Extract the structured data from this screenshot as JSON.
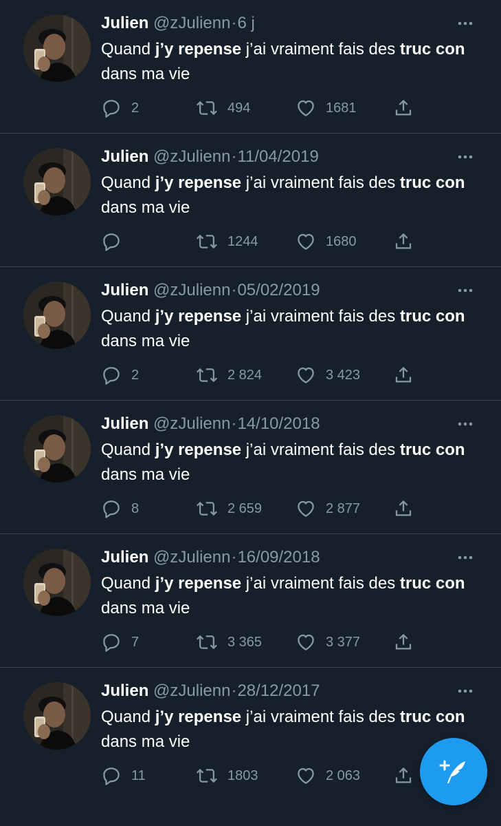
{
  "colors": {
    "background": "#15202b",
    "divider": "#38444d",
    "secondary_text": "#8899a6",
    "accent": "#1d9bf0"
  },
  "tweets": [
    {
      "name": "Julien",
      "handle": "@zJulienn",
      "separator": "·",
      "time": "6 j",
      "text": {
        "p1": "Quand ",
        "b1": "j’y repense",
        "p2": " j’ai vraiment fais des ",
        "b2": "truc con",
        "p3": " dans ma vie"
      },
      "replies": "2",
      "retweets": "494",
      "likes": "1681"
    },
    {
      "name": "Julien",
      "handle": "@zJulienn",
      "separator": "·",
      "time": "11/04/2019",
      "text": {
        "p1": "Quand ",
        "b1": "j’y repense",
        "p2": " j’ai vraiment fais des ",
        "b2": "truc con",
        "p3": " dans ma vie"
      },
      "replies": "",
      "retweets": "1244",
      "likes": "1680"
    },
    {
      "name": "Julien",
      "handle": "@zJulienn",
      "separator": "·",
      "time": "05/02/2019",
      "text": {
        "p1": "Quand ",
        "b1": "j’y repense",
        "p2": " j’ai vraiment fais des ",
        "b2": "truc con",
        "p3": " dans ma vie"
      },
      "replies": "2",
      "retweets": "2 824",
      "likes": "3 423"
    },
    {
      "name": "Julien",
      "handle": "@zJulienn",
      "separator": "·",
      "time": "14/10/2018",
      "text": {
        "p1": "Quand ",
        "b1": "j’y repense",
        "p2": " j’ai vraiment fais des ",
        "b2": "truc con",
        "p3": " dans ma vie"
      },
      "replies": "8",
      "retweets": "2 659",
      "likes": "2 877"
    },
    {
      "name": "Julien",
      "handle": "@zJulienn",
      "separator": "·",
      "time": "16/09/2018",
      "text": {
        "p1": "Quand ",
        "b1": "j’y repense",
        "p2": " j’ai vraiment fais des ",
        "b2": "truc con",
        "p3": " dans ma vie"
      },
      "replies": "7",
      "retweets": "3 365",
      "likes": "3 377"
    },
    {
      "name": "Julien",
      "handle": "@zJulienn",
      "separator": "·",
      "time": "28/12/2017",
      "text": {
        "p1": "Quand ",
        "b1": "j’y repense",
        "p2": " j’ai vraiment fais des ",
        "b2": "truc con",
        "p3": " dans ma vie"
      },
      "replies": "11",
      "retweets": "1803",
      "likes": "2 063"
    }
  ],
  "icons": {
    "more": "more-dots-icon",
    "reply": "reply-icon",
    "retweet": "retweet-icon",
    "like": "heart-icon",
    "share": "share-icon",
    "compose": "compose-tweet-icon"
  }
}
